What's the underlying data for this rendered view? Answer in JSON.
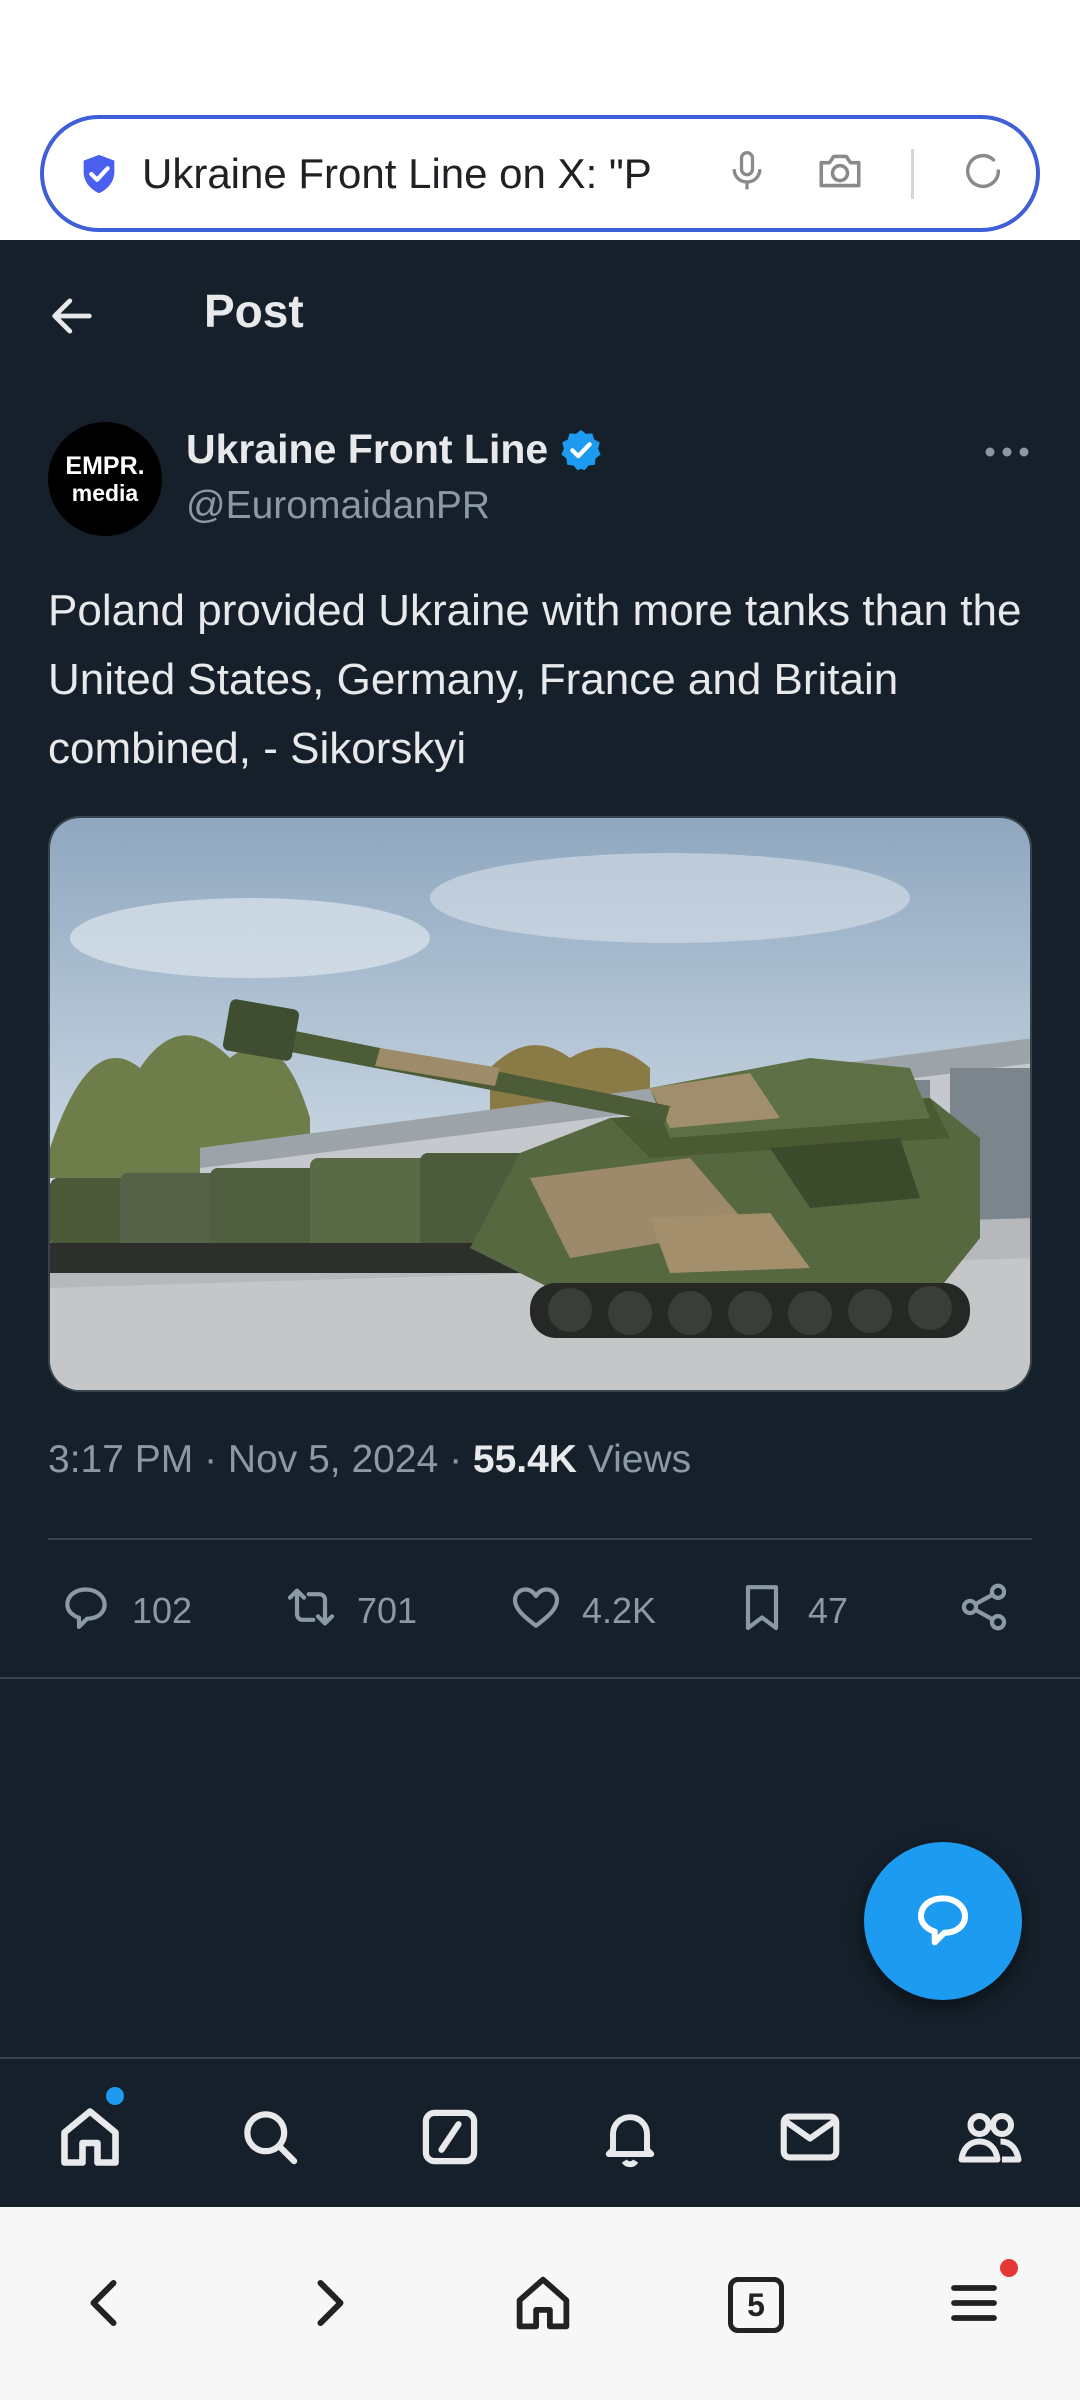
{
  "browser": {
    "url_text": "Ukraine Front Line on X: \"P",
    "shield_icon": "shield-check-icon",
    "tabs_count": "5",
    "accent_color": "#3f5fd9"
  },
  "header": {
    "title": "Post"
  },
  "post": {
    "author_avatar_line1": "EMPR.",
    "author_avatar_line2": "media",
    "author_name": "Ukraine Front Line",
    "author_handle": "@EuromaidanPR",
    "text": "Poland provided Ukraine with more tanks than the United States, Germany, France and Britain combined, - Sikorskyi",
    "time": "3:17 PM",
    "date": "Nov 5, 2024",
    "views_count": "55.4K",
    "views_label": "Views",
    "replies": "102",
    "reposts": "701",
    "likes": "4.2K",
    "bookmarks": "47"
  },
  "colors": {
    "background": "#15202b",
    "accent": "#1d9bf0",
    "muted": "#8b98a5"
  }
}
